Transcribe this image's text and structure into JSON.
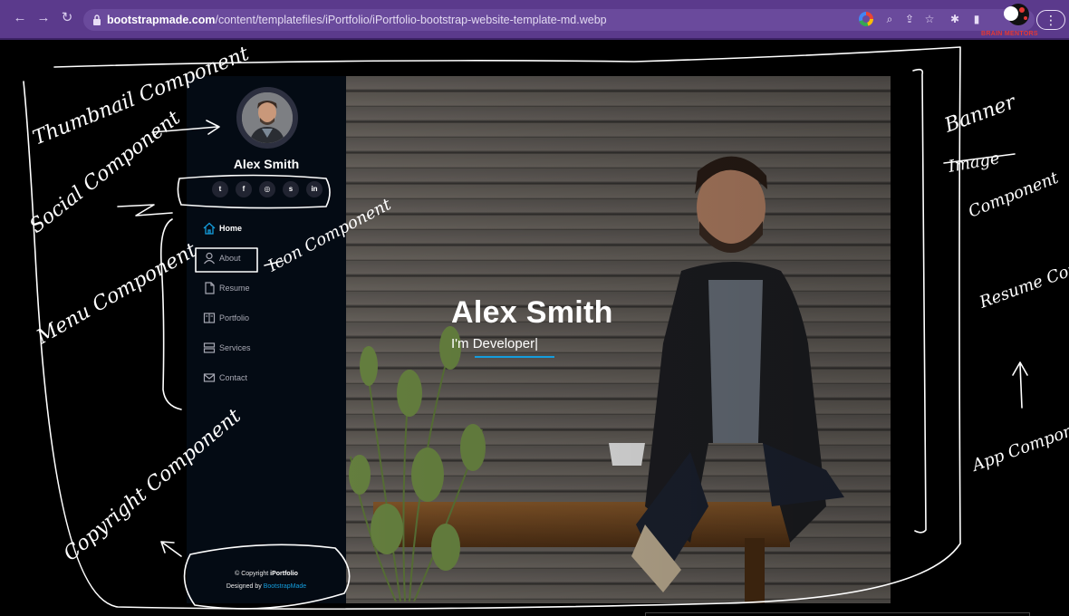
{
  "browser": {
    "url_host": "bootstrapmade.com",
    "url_path": "/content/templatefiles/iPortfolio/iPortfolio-bootstrap-website-template-md.webp",
    "icons": [
      "back-icon",
      "forward-icon",
      "reload-icon",
      "lock-icon",
      "google-icon",
      "zoom-icon",
      "share-icon",
      "star-icon",
      "extensions-icon",
      "sidebar-icon",
      "menu-icon"
    ],
    "channel_logo_text": "BRAIN MENTORS"
  },
  "site": {
    "profile_name": "Alex Smith",
    "social": [
      {
        "name": "twitter-icon",
        "glyph": "t"
      },
      {
        "name": "facebook-icon",
        "glyph": "f"
      },
      {
        "name": "instagram-icon",
        "glyph": "◎"
      },
      {
        "name": "skype-icon",
        "glyph": "s"
      },
      {
        "name": "linkedin-icon",
        "glyph": "in"
      }
    ],
    "menu": [
      {
        "label": "Home",
        "active": true,
        "icon": "home-icon"
      },
      {
        "label": "About",
        "active": false,
        "icon": "person-icon"
      },
      {
        "label": "Resume",
        "active": false,
        "icon": "file-icon"
      },
      {
        "label": "Portfolio",
        "active": false,
        "icon": "book-icon"
      },
      {
        "label": "Services",
        "active": false,
        "icon": "server-icon"
      },
      {
        "label": "Contact",
        "active": false,
        "icon": "envelope-icon"
      }
    ],
    "footer": {
      "copyright_prefix": "© Copyright ",
      "copyright_brand": "iPortfolio",
      "designed_prefix": "Designed by ",
      "designed_link": "BootstrapMade"
    },
    "hero": {
      "title": "Alex Smith",
      "subtitle": "I'm Developer|"
    },
    "accent_color": "#149ddd"
  },
  "annotations": {
    "thumbnail": "Thumbnail Component",
    "social": "Social Component",
    "menu": "Menu Component",
    "icon": "Icon Component",
    "copyright": "Copyright Component",
    "banner": "Banner",
    "banner_struck": "Image",
    "banner_component": "Component",
    "resume": "Resume Component",
    "app": "App Component"
  }
}
